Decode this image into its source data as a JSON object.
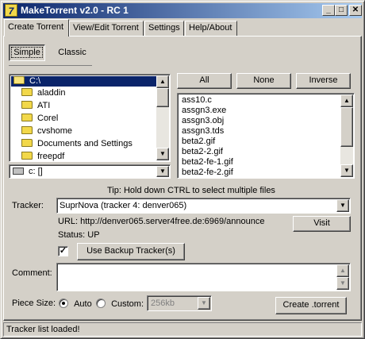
{
  "window": {
    "title": "MakeTorrent v2.0 - RC 1",
    "app_icon_glyph": "7",
    "minimize_glyph": "_",
    "maximize_glyph": "□",
    "close_glyph": "✕"
  },
  "tabs": [
    {
      "label": "Create Torrent",
      "active": true
    },
    {
      "label": "View/Edit Torrent",
      "active": false
    },
    {
      "label": "Settings",
      "active": false
    },
    {
      "label": "Help/About",
      "active": false
    }
  ],
  "mode_tabs": {
    "simple": "Simple",
    "classic": "Classic",
    "selected": "Simple"
  },
  "folder_list": {
    "items": [
      "C:\\",
      "aladdin",
      "ATI",
      "Corel",
      "cvshome",
      "Documents and Settings",
      "freepdf"
    ],
    "selected": "C:\\"
  },
  "drive_select": {
    "value": "c: []"
  },
  "file_buttons": {
    "all": "All",
    "none": "None",
    "inverse": "Inverse"
  },
  "file_list": {
    "items": [
      "ass10.c",
      "assgn3.exe",
      "assgn3.obj",
      "assgn3.tds",
      "beta2.gif",
      "beta2-2.gif",
      "beta2-fe-1.gif",
      "beta2-fe-2.gif"
    ]
  },
  "tip": "Tip: Hold down CTRL to select multiple files",
  "tracker": {
    "label": "Tracker:",
    "value": "SuprNova (tracker 4: denver065)",
    "url": "URL: http://denver065.server4free.de:6969/announce",
    "status": "Status: UP",
    "visit": "Visit",
    "backup_checked": true,
    "backup_label": "Use Backup Tracker(s)"
  },
  "comment": {
    "label": "Comment:",
    "value": ""
  },
  "piece_size": {
    "label": "Piece Size:",
    "auto": "Auto",
    "custom": "Custom:",
    "selected": "Auto",
    "custom_value": "256kb"
  },
  "create_button": "Create .torrent",
  "status_bar": "Tracker list loaded!",
  "colors": {
    "title_gradient_start": "#0a246a",
    "title_gradient_end": "#a6caf0",
    "selection": "#0a246a",
    "face": "#d4d0c8"
  },
  "icons": {
    "folder": "folder-icon",
    "drive": "drive-icon",
    "app": "app-icon"
  }
}
